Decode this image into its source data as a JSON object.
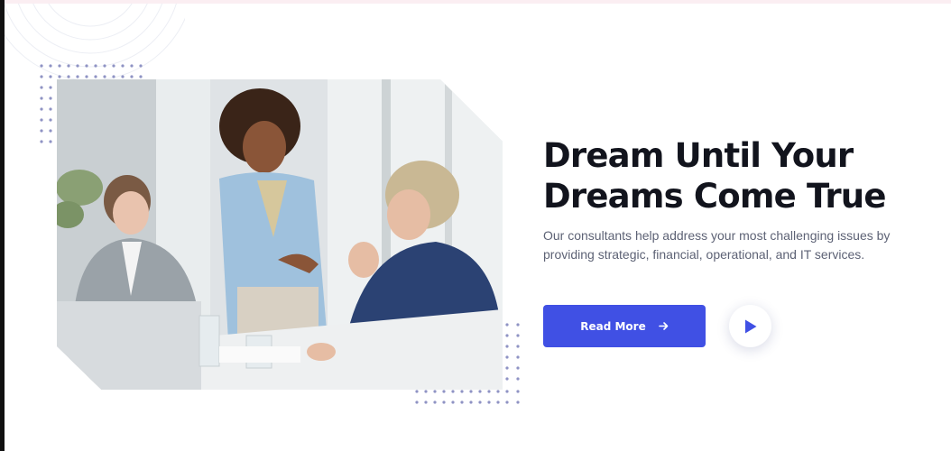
{
  "hero": {
    "title_line1": "Dream Until Your",
    "title_line2": "Dreams Come True",
    "description": "Our consultants help address your most challenging issues by providing strategic, financial, operational, and IT services.",
    "image_alt": "Business consultants meeting around a table"
  },
  "actions": {
    "read_more_label": "Read More",
    "read_more_icon": "arrow-right-icon",
    "play_icon": "play-icon"
  },
  "colors": {
    "accent": "#4050e4",
    "title": "#12141d",
    "text": "#5d6275",
    "dots": "#8f93c4"
  }
}
